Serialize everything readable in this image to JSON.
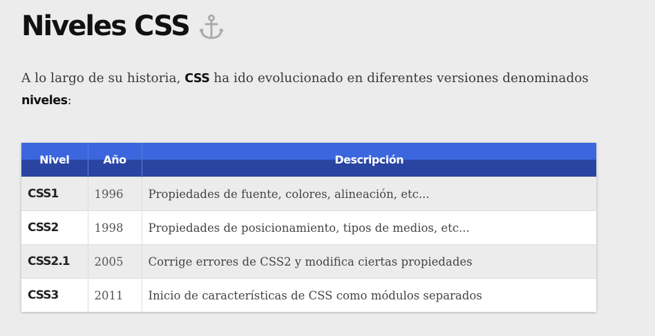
{
  "heading": {
    "title": "Niveles CSS",
    "icon": "anchor-icon"
  },
  "intro": {
    "part1": "A lo largo de su historia, ",
    "bold1": "CSS",
    "part2": " ha ido evolucionado en diferentes versiones denominados ",
    "bold2": "niveles",
    "part3": ":"
  },
  "table": {
    "columns": [
      "Nivel",
      "Año",
      "Descripción"
    ],
    "rows": [
      {
        "level": "CSS1",
        "year": "1996",
        "description": "Propiedades de fuente, colores, alineación, etc..."
      },
      {
        "level": "CSS2",
        "year": "1998",
        "description": "Propiedades de posicionamiento, tipos de medios, etc..."
      },
      {
        "level": "CSS2.1",
        "year": "2005",
        "description": "Corrige errores de CSS2 y modifica ciertas propiedades"
      },
      {
        "level": "CSS3",
        "year": "2011",
        "description": "Inicio de características de CSS como módulos separados"
      }
    ]
  },
  "colors": {
    "header_top": "#3b66dd",
    "header_bottom": "#2945a1",
    "page_background": "#ececec"
  }
}
